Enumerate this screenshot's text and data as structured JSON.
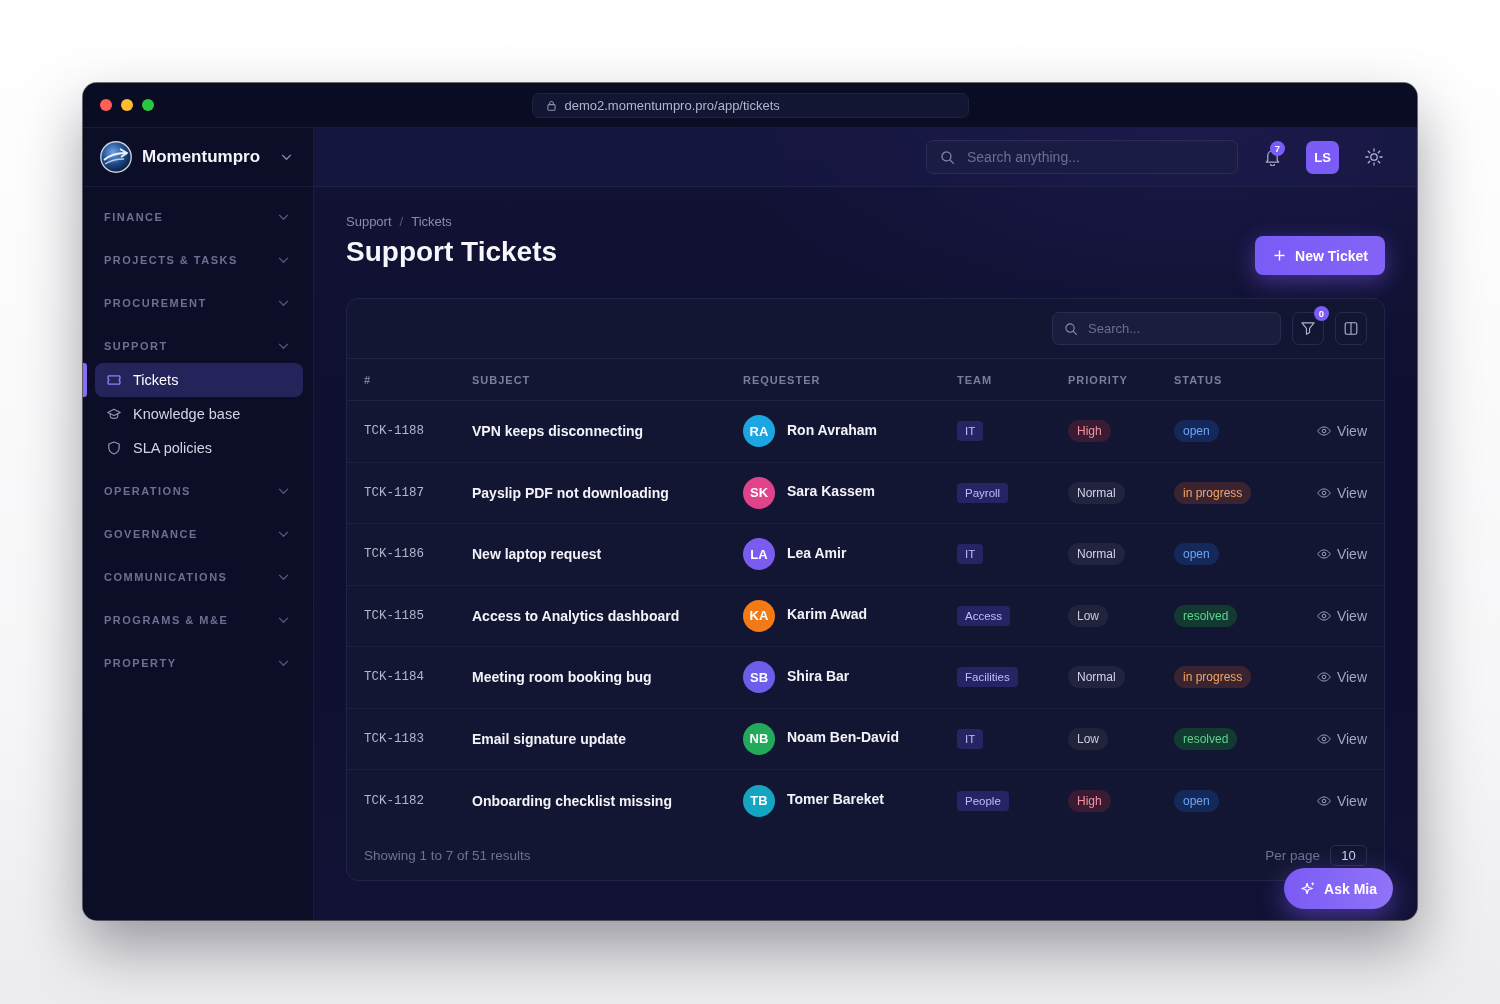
{
  "browser": {
    "url": "demo2.momentumpro.pro/app/tickets"
  },
  "sidebar": {
    "brand": "Momentumpro",
    "sections": [
      {
        "label": "FINANCE"
      },
      {
        "label": "PROJECTS & TASKS"
      },
      {
        "label": "PROCUREMENT"
      },
      {
        "label": "SUPPORT",
        "items": [
          {
            "label": "Tickets",
            "selected": true
          },
          {
            "label": "Knowledge base",
            "selected": false
          },
          {
            "label": "SLA policies",
            "selected": false
          }
        ]
      },
      {
        "label": "OPERATIONS"
      },
      {
        "label": "GOVERNANCE"
      },
      {
        "label": "COMMUNICATIONS"
      },
      {
        "label": "PROGRAMS & M&E"
      },
      {
        "label": "PROPERTY"
      }
    ]
  },
  "topbar": {
    "search": {
      "placeholder": "Search anything..."
    },
    "notification_count": "7",
    "user_initials": "LS"
  },
  "page": {
    "breadcrumb": {
      "items": [
        "Support",
        "Tickets"
      ],
      "separator": "/"
    },
    "title": "Support Tickets",
    "new_button": "New Ticket"
  },
  "table": {
    "search": {
      "placeholder": "Search..."
    },
    "filter_count": "0",
    "columns": [
      "#",
      "SUBJECT",
      "REQUESTER",
      "TEAM",
      "PRIORITY",
      "STATUS"
    ],
    "rows": [
      {
        "id": "TCK-1188",
        "subject": "VPN keeps disconnecting",
        "requester": {
          "initials": "RA",
          "name": "Ron Avraham",
          "color": "#1ba6e2"
        },
        "team": "IT",
        "priority": {
          "label": "High",
          "kind": "high"
        },
        "status": {
          "label": "open",
          "kind": "open"
        },
        "action": "View"
      },
      {
        "id": "TCK-1187",
        "subject": "Payslip PDF not downloading",
        "requester": {
          "initials": "SK",
          "name": "Sara Kassem",
          "color": "#e0428c"
        },
        "team": "Payroll",
        "priority": {
          "label": "Normal",
          "kind": "normal"
        },
        "status": {
          "label": "in progress",
          "kind": "in_progress"
        },
        "action": "View"
      },
      {
        "id": "TCK-1186",
        "subject": "New laptop request",
        "requester": {
          "initials": "LA",
          "name": "Lea Amir",
          "color": "#7b5cf0"
        },
        "team": "IT",
        "priority": {
          "label": "Normal",
          "kind": "normal"
        },
        "status": {
          "label": "open",
          "kind": "open"
        },
        "action": "View"
      },
      {
        "id": "TCK-1185",
        "subject": "Access to Analytics dashboard",
        "requester": {
          "initials": "KA",
          "name": "Karim Awad",
          "color": "#f27a17"
        },
        "team": "Access",
        "priority": {
          "label": "Low",
          "kind": "low"
        },
        "status": {
          "label": "resolved",
          "kind": "resolved"
        },
        "action": "View"
      },
      {
        "id": "TCK-1184",
        "subject": "Meeting room booking bug",
        "requester": {
          "initials": "SB",
          "name": "Shira Bar",
          "color": "#6d5de8"
        },
        "team": "Facilities",
        "priority": {
          "label": "Normal",
          "kind": "normal"
        },
        "status": {
          "label": "in progress",
          "kind": "in_progress"
        },
        "action": "View"
      },
      {
        "id": "TCK-1183",
        "subject": "Email signature update",
        "requester": {
          "initials": "NB",
          "name": "Noam Ben-David",
          "color": "#22a95b"
        },
        "team": "IT",
        "priority": {
          "label": "Low",
          "kind": "low"
        },
        "status": {
          "label": "resolved",
          "kind": "resolved"
        },
        "action": "View"
      },
      {
        "id": "TCK-1182",
        "subject": "Onboarding checklist missing",
        "requester": {
          "initials": "TB",
          "name": "Tomer Bareket",
          "color": "#14a5c3"
        },
        "team": "People",
        "priority": {
          "label": "High",
          "kind": "high"
        },
        "status": {
          "label": "open",
          "kind": "open"
        },
        "action": "View"
      }
    ],
    "footer": {
      "summary": "Showing 1 to 7 of 51 results",
      "per_page_label": "Per page",
      "per_page": "10"
    }
  },
  "assistant_button": "Ask Mia"
}
